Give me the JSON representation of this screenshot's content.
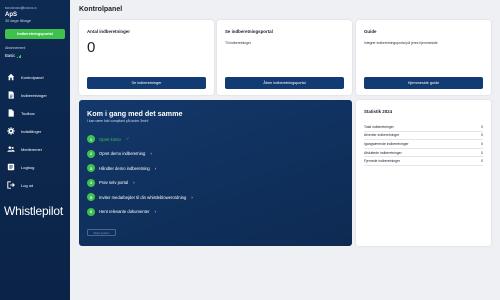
{
  "sidebar": {
    "email": "s•••••••••••@•••••••.••",
    "company": "ApS",
    "days_left": "30 dage tilbage",
    "submit_button": "Indberetningsportal",
    "subscription_label": "Abonnement",
    "plan": "Basic",
    "items": [
      {
        "label": "Kontrolpanel",
        "icon": "home-icon"
      },
      {
        "label": "Indberetninger",
        "icon": "document-icon"
      },
      {
        "label": "Toolbox",
        "icon": "file-icon"
      },
      {
        "label": "Indstillinger",
        "icon": "gear-icon"
      },
      {
        "label": "Medlemmer",
        "icon": "users-icon"
      },
      {
        "label": "Logbog",
        "icon": "list-icon"
      },
      {
        "label": "Log ud",
        "icon": "logout-icon"
      }
    ],
    "logo": "Whistlepilot"
  },
  "page": {
    "title": "Kontrolpanel"
  },
  "cards": {
    "reports": {
      "title": "Antal indberetninger",
      "count": "0",
      "button": "Se indberetninger"
    },
    "portal": {
      "title": "Se indberetningsportal",
      "desc": "Til indberetninger",
      "button": "Åben indberetningsportal"
    },
    "guide": {
      "title": "Guide",
      "desc": "Integrer indberetningsportal på jeres hjemmeside",
      "button": "Hjemmeside guide"
    }
  },
  "getting_started": {
    "title": "Kom i gang med det samme",
    "subtitle": "I kan være fuld compliant på under 3min!",
    "steps": [
      {
        "num": "1",
        "label": "Opret konto",
        "done": true
      },
      {
        "num": "2",
        "label": "Opret demo indberetning",
        "done": false
      },
      {
        "num": "3",
        "label": "Håndter demo indberetning",
        "done": false
      },
      {
        "num": "4",
        "label": "Prøv selv portal",
        "done": false
      },
      {
        "num": "5",
        "label": "Inviter medarbejder til din whistleblowerordning",
        "done": false
      },
      {
        "num": "6",
        "label": "Hent relevante dokumenter",
        "done": false
      }
    ],
    "hide_button": "Skjul guiden"
  },
  "stats": {
    "title": "Statistik 2024",
    "rows": [
      {
        "label": "Total indberetninger",
        "value": "0"
      },
      {
        "label": "Afventer indberetninger",
        "value": "0"
      },
      {
        "label": "Igangværende indberetninger",
        "value": "0"
      },
      {
        "label": "Afsluttede indberetninger",
        "value": "0"
      },
      {
        "label": "Fjernede indberetninger",
        "value": "0"
      }
    ]
  },
  "colors": {
    "sidebar": "#0d2a52",
    "accent_green": "#3ec14d",
    "button_blue": "#133b73"
  }
}
